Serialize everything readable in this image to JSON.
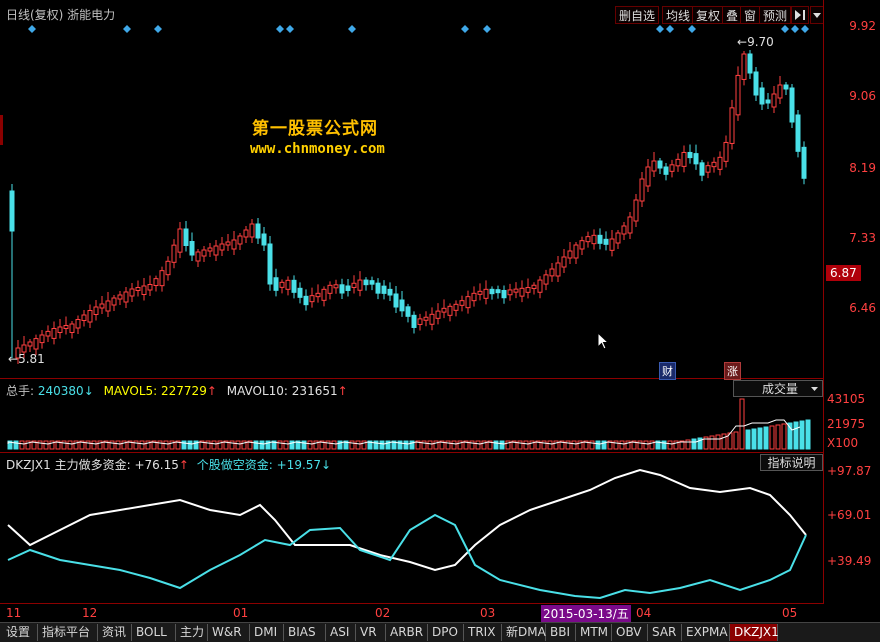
{
  "header": {
    "title": "日线(复权) 浙能电力",
    "buttons": [
      "删自选",
      "均线",
      "复权",
      "叠",
      "窗",
      "预测"
    ],
    "nav_icon": "arrow-right-bar-icon",
    "menu_icon": "chevron-down-icon"
  },
  "watermark": {
    "line1": "第一股票公式网",
    "line2": "www.chnmoney.com"
  },
  "price_axis": {
    "labels": [
      "9.92",
      "9.06",
      "8.19",
      "7.33",
      "6.46"
    ],
    "current": "6.87",
    "high_marker": "9.70",
    "low_marker": "5.81"
  },
  "markers": {
    "cai": "财",
    "zhang": "涨"
  },
  "volume_panel": {
    "label_total": "总手:",
    "total": "240380",
    "label_ma5": "MAVOL5:",
    "ma5": "227729",
    "label_ma10": "MAVOL10:",
    "ma10": "231651",
    "selector": "成交量",
    "axis": [
      "43105",
      "21975"
    ],
    "unit": "X100"
  },
  "indicator_panel": {
    "name": "DKZJX1",
    "label_main": "主力做多资金:",
    "main_value": "+76.15",
    "label_retail": "个股做空资金:",
    "retail_value": "+19.57",
    "help": "指标说明",
    "axis": [
      "+97.87",
      "+69.01",
      "+39.49"
    ]
  },
  "x_axis": {
    "labels": [
      "11",
      "12",
      "01",
      "02",
      "03",
      "04",
      "05"
    ],
    "cursor_date": "2015-03-13/五"
  },
  "tabs": [
    "设置",
    "指标平台",
    "资讯",
    "BOLL",
    "主力",
    "W&R",
    "DMI",
    "BIAS",
    "ASI",
    "VR",
    "ARBR",
    "DPO",
    "TRIX",
    "新DMA",
    "BBI",
    "MTM",
    "OBV",
    "SAR",
    "EXPMA",
    "DKZJX1"
  ],
  "active_tab": "DKZJX1",
  "colors": {
    "up": "#ff4040",
    "down": "#4ae0e8",
    "bg": "#000000",
    "white_line": "#ffffff",
    "cyan_line": "#4ae0e8",
    "diamond": "#3fa8e8",
    "ma5": "#ffff00",
    "ma10": "#ff00ff"
  }
}
